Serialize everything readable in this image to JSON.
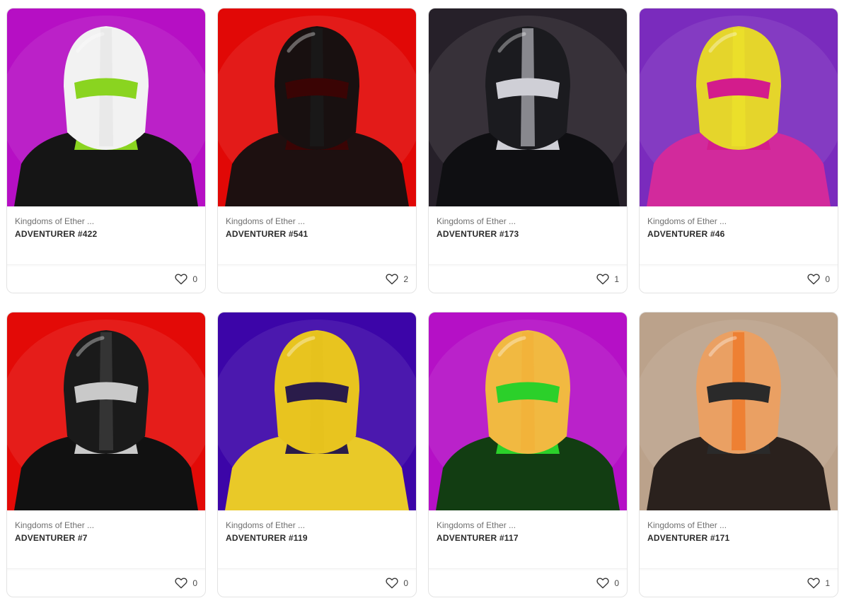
{
  "cards": [
    {
      "collection": "Kingdoms of Ether ...",
      "title": "ADVENTURER #422",
      "likes": "0",
      "bg": "#b60fc4",
      "accent": "#e8e8e8",
      "accent2": "#8ad420",
      "helmet": "#f2f2f2",
      "body": "#151515"
    },
    {
      "collection": "Kingdoms of Ether ...",
      "title": "ADVENTURER #541",
      "likes": "2",
      "bg": "#e10806",
      "accent": "#1a1a1a",
      "accent2": "#3a0404",
      "helmet": "#181010",
      "body": "#1d1010"
    },
    {
      "collection": "Kingdoms of Ether ...",
      "title": "ADVENTURER #173",
      "likes": "1",
      "bg": "#262029",
      "accent": "#9b9ba2",
      "accent2": "#cfcfd6",
      "helmet": "#1b1b1f",
      "body": "#0f0f12"
    },
    {
      "collection": "Kingdoms of Ether ...",
      "title": "ADVENTURER #46",
      "likes": "0",
      "bg": "#7a2bbd",
      "accent": "#ece12a",
      "accent2": "#d31c8c",
      "helmet": "#e5d52b",
      "body": "#d22a9c"
    },
    {
      "collection": "Kingdoms of Ether ...",
      "title": "ADVENTURER #7",
      "likes": "0",
      "bg": "#e30a07",
      "accent": "#3a3a3a",
      "accent2": "#c9c9c9",
      "helmet": "#1a1a1a",
      "body": "#111111"
    },
    {
      "collection": "Kingdoms of Ether ...",
      "title": "ADVENTURER #119",
      "likes": "0",
      "bg": "#3c05a8",
      "accent": "#e5c21d",
      "accent2": "#2a1c4a",
      "helmet": "#e8c41f",
      "body": "#e9c928"
    },
    {
      "collection": "Kingdoms of Ether ...",
      "title": "ADVENTURER #117",
      "likes": "0",
      "bg": "#b510c6",
      "accent": "#f2b23a",
      "accent2": "#2bd02a",
      "helmet": "#f1b941",
      "body": "#123d12"
    },
    {
      "collection": "Kingdoms of Ether ...",
      "title": "ADVENTURER #171",
      "likes": "1",
      "bg": "#bba28b",
      "accent": "#ee7a2a",
      "accent2": "#2a2a2a",
      "helmet": "#eaa063",
      "body": "#2a211d"
    }
  ]
}
